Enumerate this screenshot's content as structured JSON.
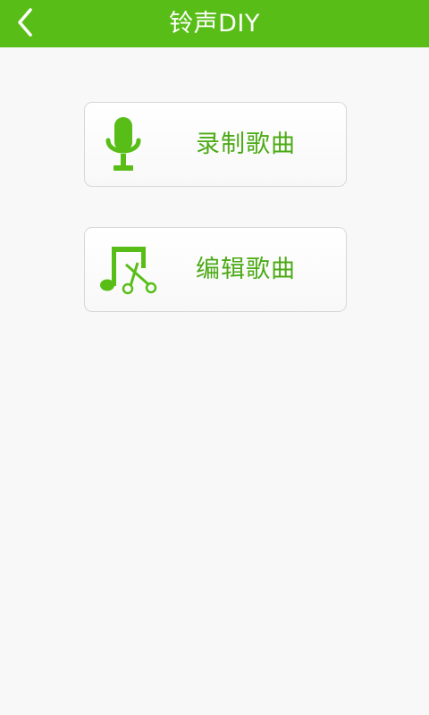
{
  "header": {
    "title": "铃声DIY",
    "back_icon": "chevron-left-icon",
    "background_color": "#58be17"
  },
  "menu": {
    "items": [
      {
        "label": "录制歌曲",
        "icon": "microphone-icon"
      },
      {
        "label": "编辑歌曲",
        "icon": "music-scissors-icon"
      }
    ],
    "accent_color": "#4caa16"
  }
}
